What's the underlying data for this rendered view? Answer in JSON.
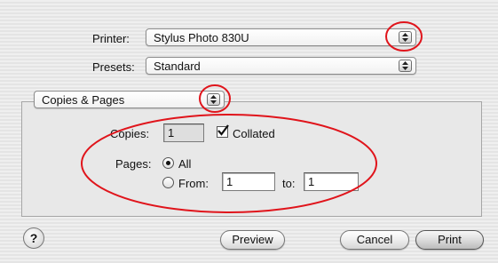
{
  "printer": {
    "label": "Printer:",
    "value": "Stylus Photo 830U"
  },
  "presets": {
    "label": "Presets:",
    "value": "Standard"
  },
  "panel_menu": {
    "value": "Copies & Pages"
  },
  "copies": {
    "label": "Copies:",
    "value": "1",
    "collated_label": "Collated",
    "collated_checked": true
  },
  "pages": {
    "label": "Pages:",
    "all_label": "All",
    "from_label": "From:",
    "from_value": "1",
    "to_label": "to:",
    "to_value": "1",
    "selected": "All"
  },
  "buttons": {
    "help": "?",
    "preview": "Preview",
    "cancel": "Cancel",
    "print": "Print"
  },
  "colors": {
    "annotation": "#e0141b"
  }
}
